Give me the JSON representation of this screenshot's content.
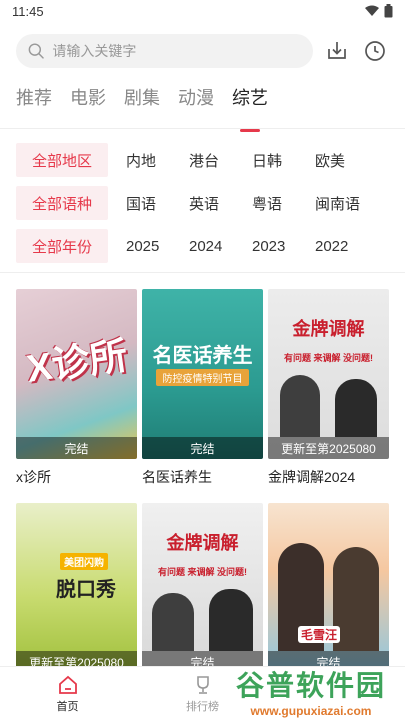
{
  "status_bar": {
    "time": "11:45"
  },
  "search": {
    "placeholder": "请输入关键字"
  },
  "tabs": [
    {
      "label": "推荐"
    },
    {
      "label": "电影"
    },
    {
      "label": "剧集"
    },
    {
      "label": "动漫"
    },
    {
      "label": "综艺",
      "active": true
    }
  ],
  "filters": {
    "region": {
      "chip": "全部地区",
      "options": [
        "内地",
        "港台",
        "日韩",
        "欧美"
      ]
    },
    "language": {
      "chip": "全部语种",
      "options": [
        "国语",
        "英语",
        "粤语",
        "闽南语"
      ]
    },
    "year": {
      "chip": "全部年份",
      "options": [
        "2025",
        "2024",
        "2023",
        "2022"
      ]
    }
  },
  "items": [
    {
      "title": "x诊所",
      "status": "完结",
      "poster_text": "X诊所"
    },
    {
      "title": "名医话养生",
      "status": "完结",
      "poster_text": "名医话养生",
      "poster_sub": "防控疫情特别节目"
    },
    {
      "title": "金牌调解2024",
      "status": "更新至第2025080",
      "poster_text": "金牌调解",
      "poster_sub": "有问题 来调解 没问题!"
    },
    {
      "title": "",
      "status": "更新至第2025080",
      "poster_text": "脱口秀",
      "poster_sub": "美团闪购"
    },
    {
      "title": "",
      "status": "完结",
      "poster_text": "金牌调解",
      "poster_sub": "有问题 来调解 没问题!"
    },
    {
      "title": "",
      "status": "完结",
      "poster_text": "毛雪汪"
    }
  ],
  "bottom_nav": [
    {
      "label": "首页",
      "icon": "home-icon",
      "active": true
    },
    {
      "label": "排行榜",
      "icon": "trophy-icon"
    }
  ],
  "watermark": {
    "line1": "谷普软件园",
    "line2": "www.gupuxiazai.com"
  },
  "colors": {
    "accent": "#e6394b",
    "chip_bg": "#fbeef0"
  }
}
